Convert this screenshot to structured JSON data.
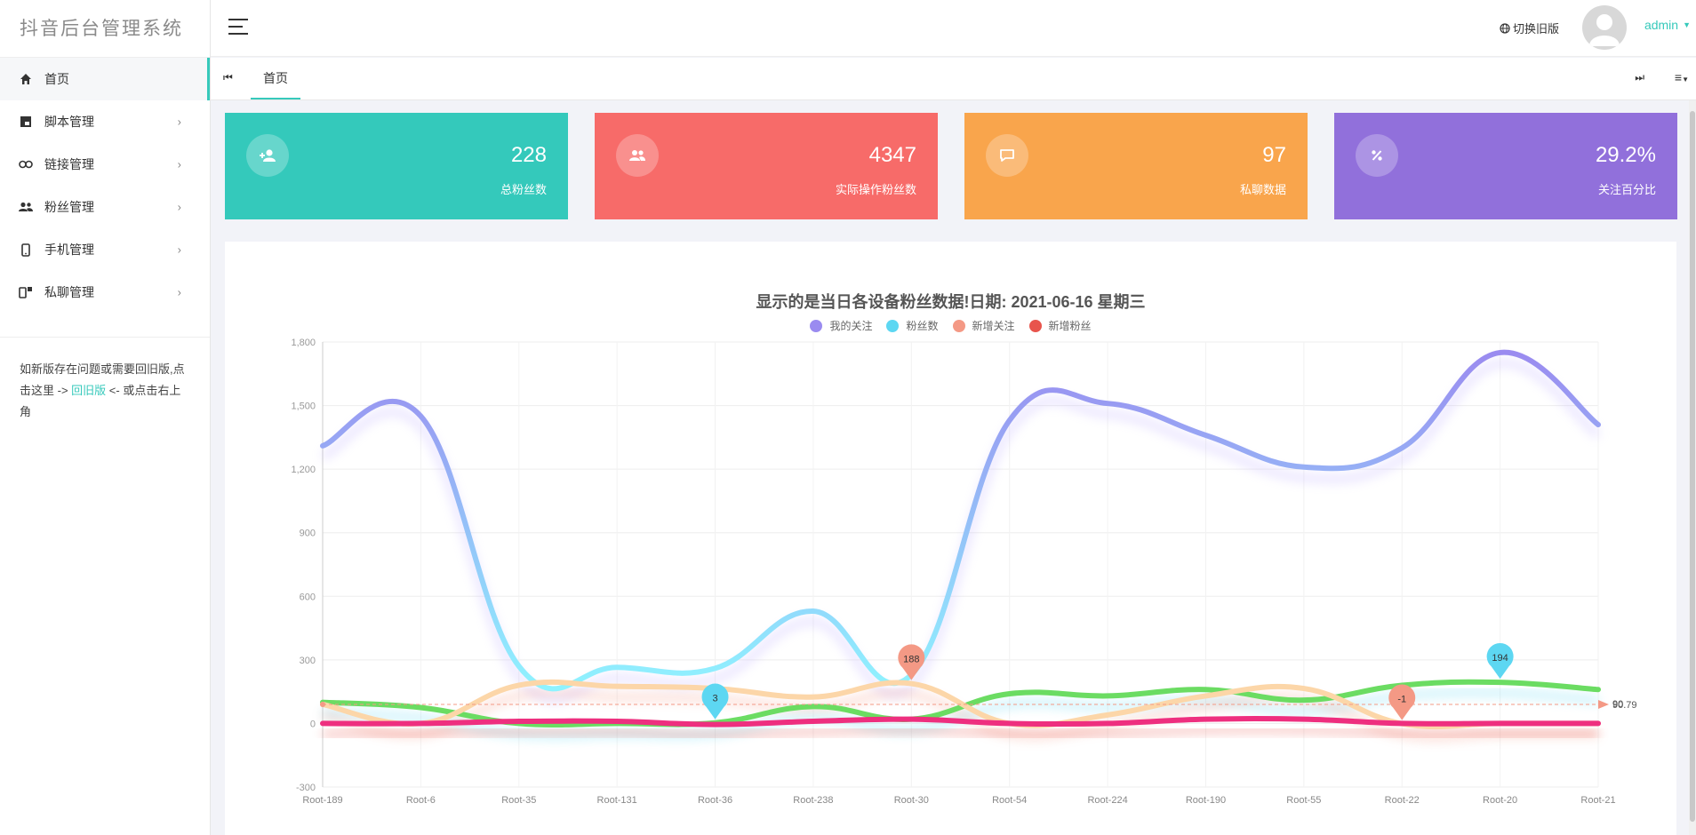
{
  "app": {
    "logo": "抖音后台管理系统"
  },
  "sidebar": {
    "items": [
      {
        "label": "首页",
        "icon": "home-icon"
      },
      {
        "label": "脚本管理",
        "icon": "js-file-icon"
      },
      {
        "label": "链接管理",
        "icon": "link-icon"
      },
      {
        "label": "粉丝管理",
        "icon": "users-icon"
      },
      {
        "label": "手机管理",
        "icon": "mobile-icon"
      },
      {
        "label": "私聊管理",
        "icon": "devices-icon"
      }
    ],
    "note_text_1": "如新版存在问题或需要回旧版,点击这里 -> ",
    "note_link": "回旧版",
    "note_text_2": " <- 或点击右上角"
  },
  "header": {
    "switch_old": "切换旧版",
    "user": "admin"
  },
  "tabs": {
    "home": "首页"
  },
  "cards": [
    {
      "value": "228",
      "label": "总粉丝数",
      "color": "#34c9bb",
      "icon": "add-user-icon"
    },
    {
      "value": "4347",
      "label": "实际操作粉丝数",
      "color": "#f76b69",
      "icon": "users-icon"
    },
    {
      "value": "97",
      "label": "私聊数据",
      "color": "#f9a54c",
      "icon": "chat-icon"
    },
    {
      "value": "29.2%",
      "label": "关注百分比",
      "color": "#9170db",
      "icon": "percent-icon"
    }
  ],
  "chart_data": {
    "type": "line",
    "title": "显示的是当日各设备粉丝数据!日期: 2021-06-16   星期三",
    "categories": [
      "Root-189",
      "Root-6",
      "Root-35",
      "Root-131",
      "Root-36",
      "Root-238",
      "Root-30",
      "Root-54",
      "Root-224",
      "Root-190",
      "Root-55",
      "Root-22",
      "Root-20",
      "Root-21"
    ],
    "ylim": [
      -300,
      1800
    ],
    "yticks": [
      "1,800",
      "1,500",
      "1,200",
      "900",
      "600",
      "300",
      "0",
      "-300"
    ],
    "series": [
      {
        "name": "我的关注",
        "color": "#9a8bf0",
        "values": [
          1310,
          1450,
          270,
          265,
          260,
          530,
          230,
          1430,
          1510,
          1360,
          1210,
          1300,
          1750,
          1410
        ]
      },
      {
        "name": "粉丝数",
        "color": "#5dd7f2",
        "values": [
          100,
          75,
          0,
          0,
          3,
          80,
          20,
          140,
          130,
          160,
          110,
          180,
          194,
          160
        ]
      },
      {
        "name": "新增关注",
        "color": "#f49985",
        "values": [
          90,
          0,
          180,
          175,
          165,
          125,
          188,
          0,
          40,
          130,
          165,
          -1,
          0,
          0
        ]
      },
      {
        "name": "新增粉丝",
        "color": "#e8544c",
        "values": [
          0,
          0,
          10,
          10,
          -5,
          10,
          20,
          0,
          0,
          20,
          20,
          0,
          0,
          0
        ]
      }
    ],
    "markers": [
      {
        "label": "3",
        "category": "Root-36",
        "value": 3,
        "color": "#5dd7f2"
      },
      {
        "label": "188",
        "category": "Root-30",
        "value": 188,
        "color": "#f49985"
      },
      {
        "label": "-1",
        "category": "Root-22",
        "value": -1,
        "color": "#f49985"
      },
      {
        "label": "194",
        "category": "Root-20",
        "value": 194,
        "color": "#5dd7f2"
      }
    ],
    "avg_line": {
      "value": 90,
      "labels": [
        "90.79",
        "90"
      ]
    }
  }
}
